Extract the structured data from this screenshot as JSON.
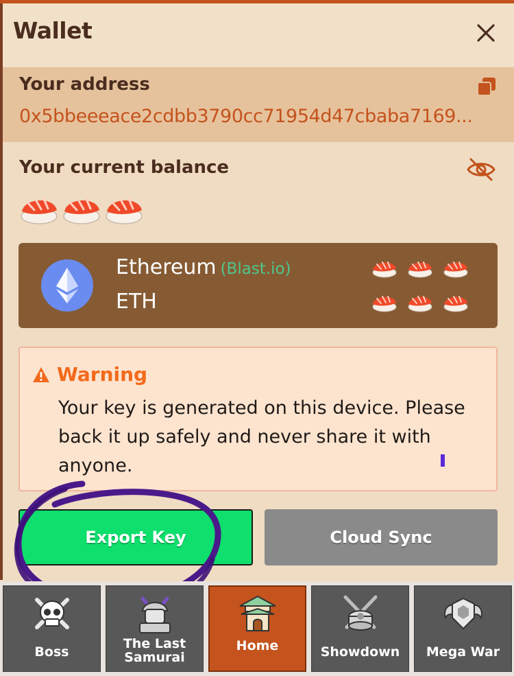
{
  "header": {
    "title": "Wallet"
  },
  "address": {
    "label": "Your address",
    "value": "0x5bbeeeace2cdbb3790cc71954d47cbaba7169..."
  },
  "balance": {
    "label": "Your current balance"
  },
  "token": {
    "name": "Ethereum",
    "network": "(Blast.io)",
    "symbol": "ETH"
  },
  "warning": {
    "title": "Warning",
    "text": "Your key is generated on this device. Please back it up safely and never share it with anyone."
  },
  "buttons": {
    "export_label": "Export Key",
    "cloud_label": "Cloud Sync"
  },
  "nav": {
    "items": [
      {
        "label": "Boss",
        "icon": "skull-icon"
      },
      {
        "label": "The Last Samurai",
        "icon": "samurai-icon"
      },
      {
        "label": "Home",
        "icon": "pagoda-icon"
      },
      {
        "label": "Showdown",
        "icon": "crossed-swords-icon"
      },
      {
        "label": "Mega War",
        "icon": "winged-shield-icon"
      }
    ],
    "active_index": 2
  },
  "colors": {
    "accent": "#c4531d",
    "export_green": "#0fdf6c",
    "warning_orange": "#f26a1b",
    "card_brown": "#865b34"
  }
}
